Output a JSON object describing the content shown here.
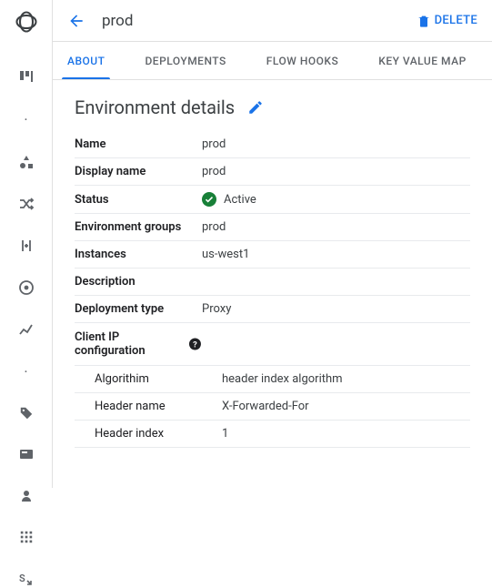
{
  "page_title": "prod",
  "delete_button": "DELETE",
  "tabs": [
    "ABOUT",
    "DEPLOYMENTS",
    "FLOW HOOKS",
    "KEY VALUE MAP"
  ],
  "section_title": "Environment details",
  "details": {
    "name_label": "Name",
    "name_value": "prod",
    "display_name_label": "Display name",
    "display_name_value": "prod",
    "status_label": "Status",
    "status_value": "Active",
    "env_groups_label": "Environment groups",
    "env_groups_value": "prod",
    "instances_label": "Instances",
    "instances_value": "us-west1",
    "description_label": "Description",
    "description_value": "",
    "deployment_type_label": "Deployment type",
    "deployment_type_value": "Proxy",
    "client_ip_label": "Client IP configuration",
    "algorithm_label": "Algorithim",
    "algorithm_value": "header index algorithm",
    "header_name_label": "Header name",
    "header_name_value": "X-Forwarded-For",
    "header_index_label": "Header index",
    "header_index_value": "1"
  }
}
